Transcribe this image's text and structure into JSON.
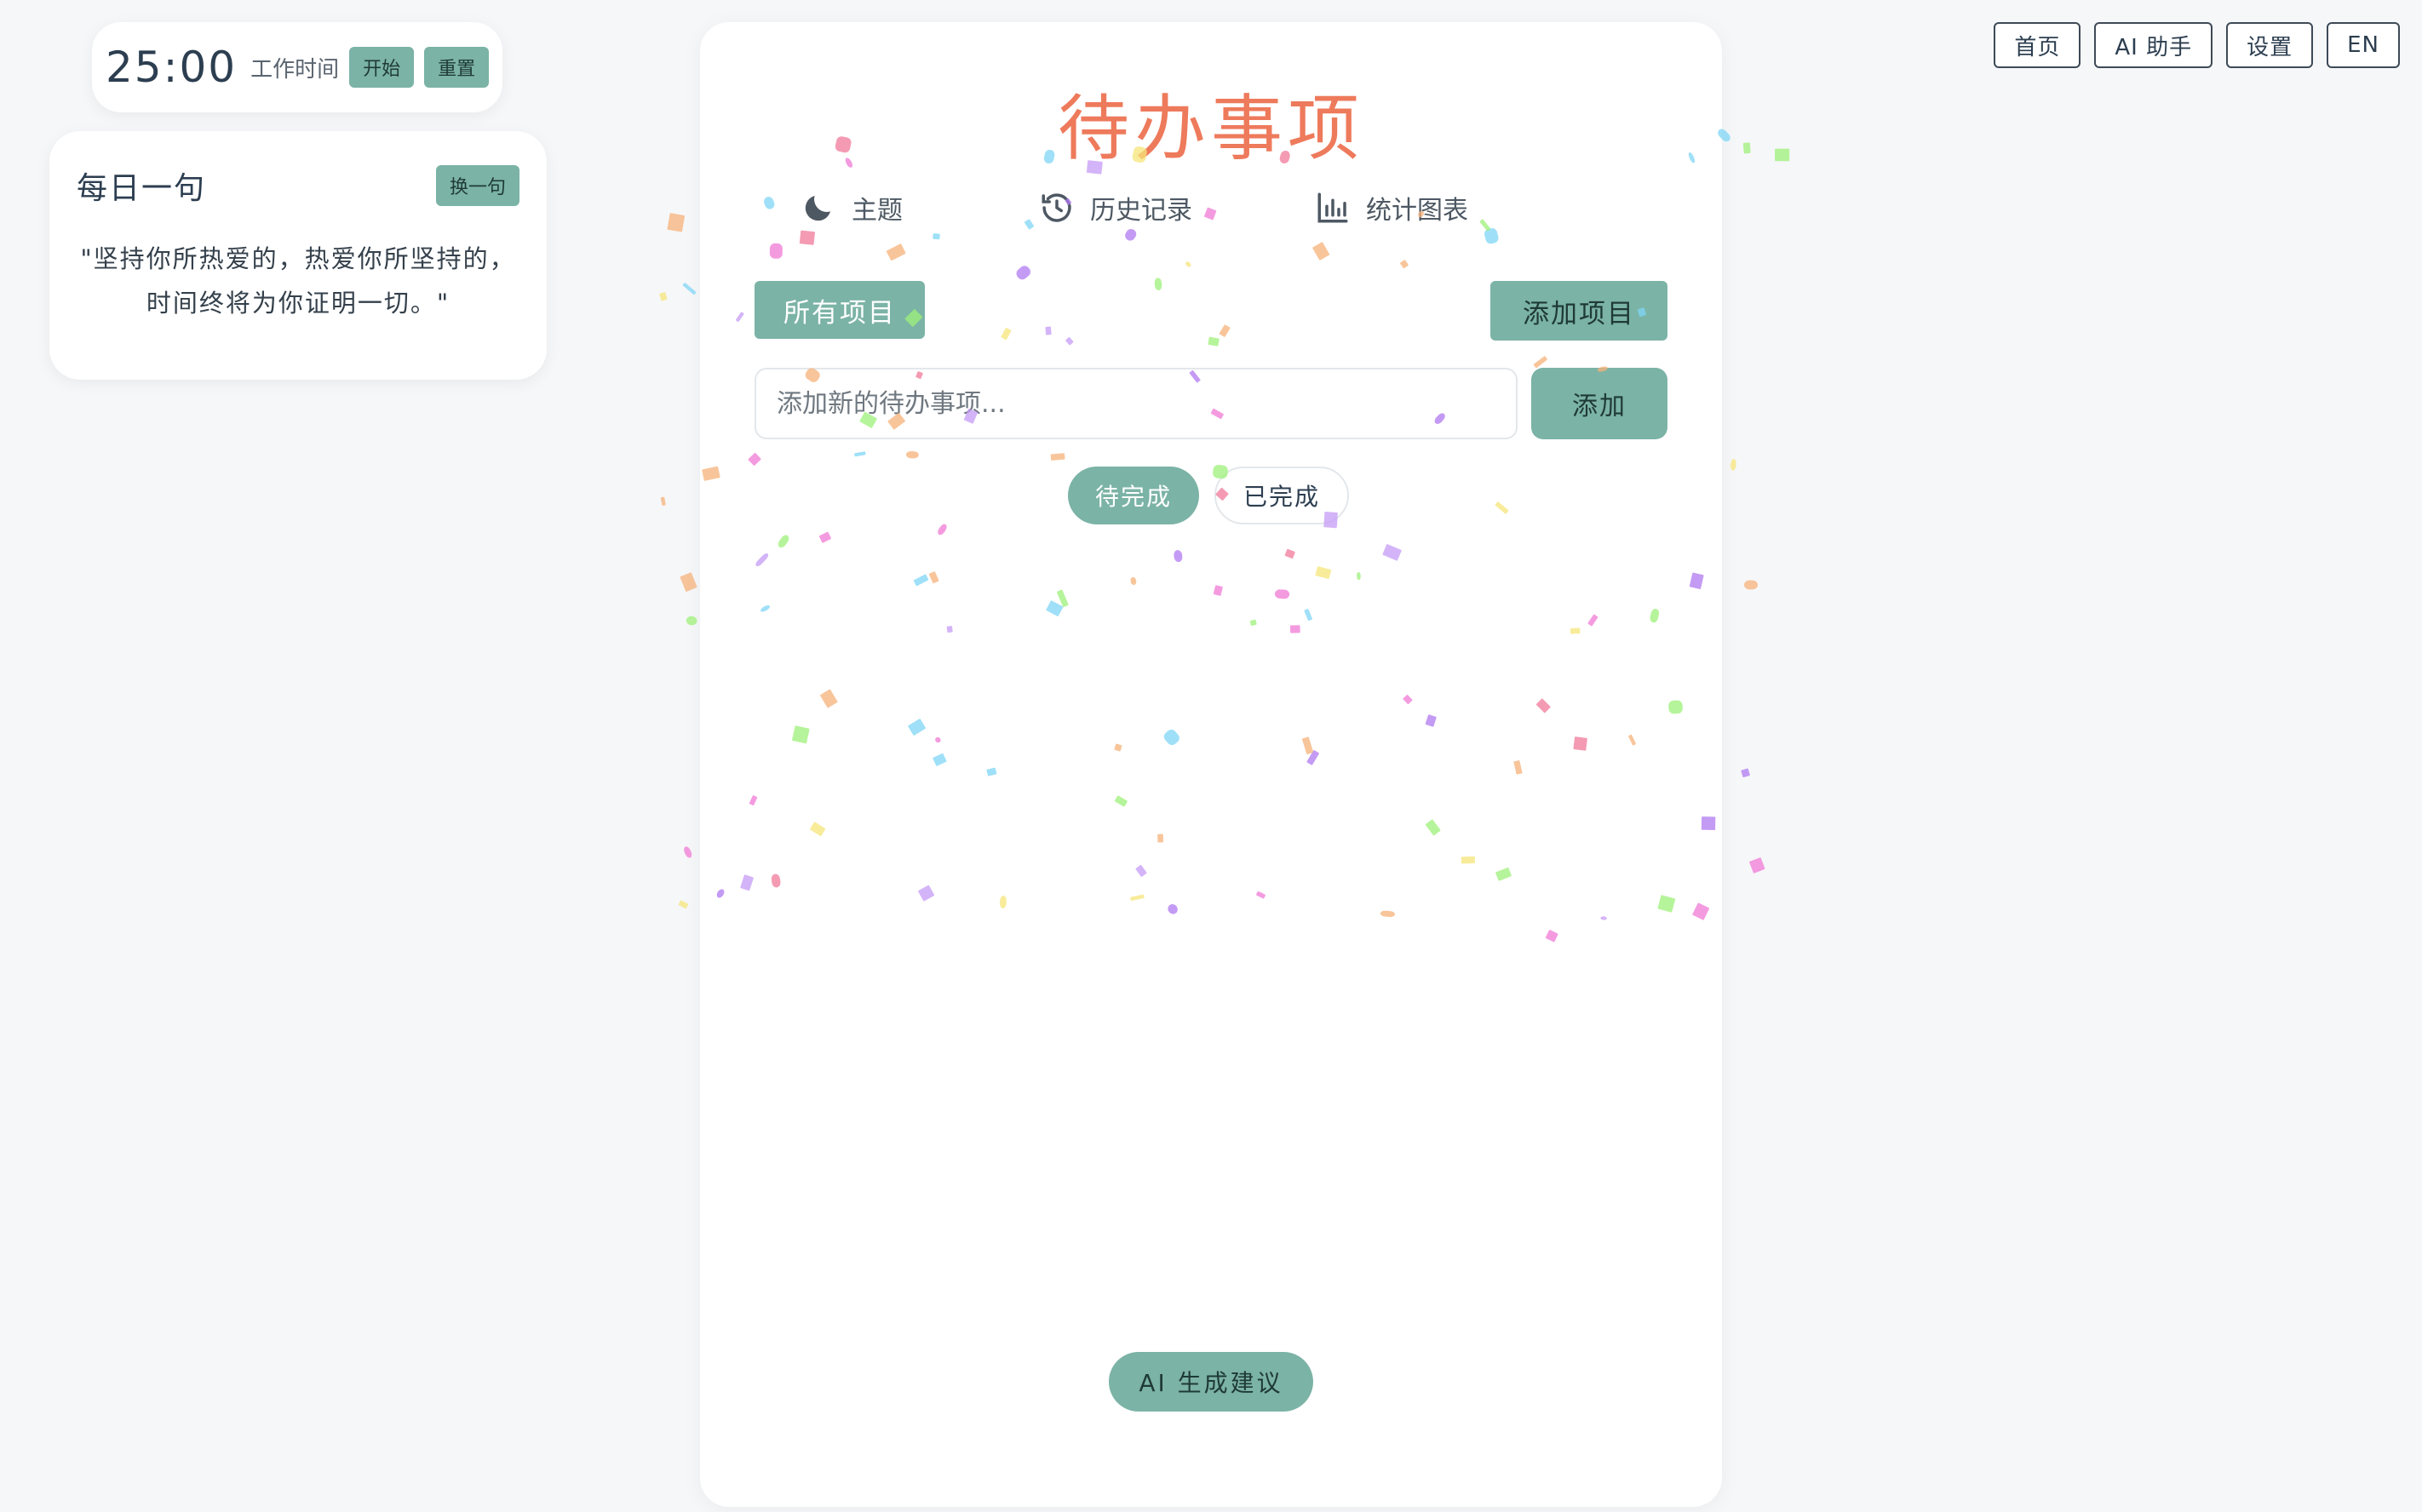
{
  "nav": {
    "home": "首页",
    "ai_assistant": "AI 助手",
    "settings": "设置",
    "language": "EN"
  },
  "timer": {
    "time": "25:00",
    "mode": "工作时间",
    "start": "开始",
    "reset": "重置"
  },
  "quote": {
    "title": "每日一句",
    "refresh": "换一句",
    "text": "\"坚持你所热爱的，热爱你所坚持的，时间终将为你证明一切。\""
  },
  "main": {
    "title": "待办事项",
    "toolbar": {
      "theme": "主题",
      "history": "历史记录",
      "stats": "统计图表"
    },
    "all_projects": "所有项目",
    "add_project": "添加项目",
    "input_placeholder": "添加新的待办事项...",
    "add_button": "添加",
    "filters": {
      "pending": "待完成",
      "completed": "已完成",
      "active": "pending"
    },
    "ai_suggest": "AI 生成建议"
  },
  "colors": {
    "accent": "#7bb3a6",
    "title": "#ee7a5c",
    "confetti": [
      "#f07ad6",
      "#c59bf5",
      "#7fd6f5",
      "#9ef07a",
      "#f5e57a",
      "#f5b27a",
      "#f07a9a",
      "#b07af0"
    ]
  }
}
